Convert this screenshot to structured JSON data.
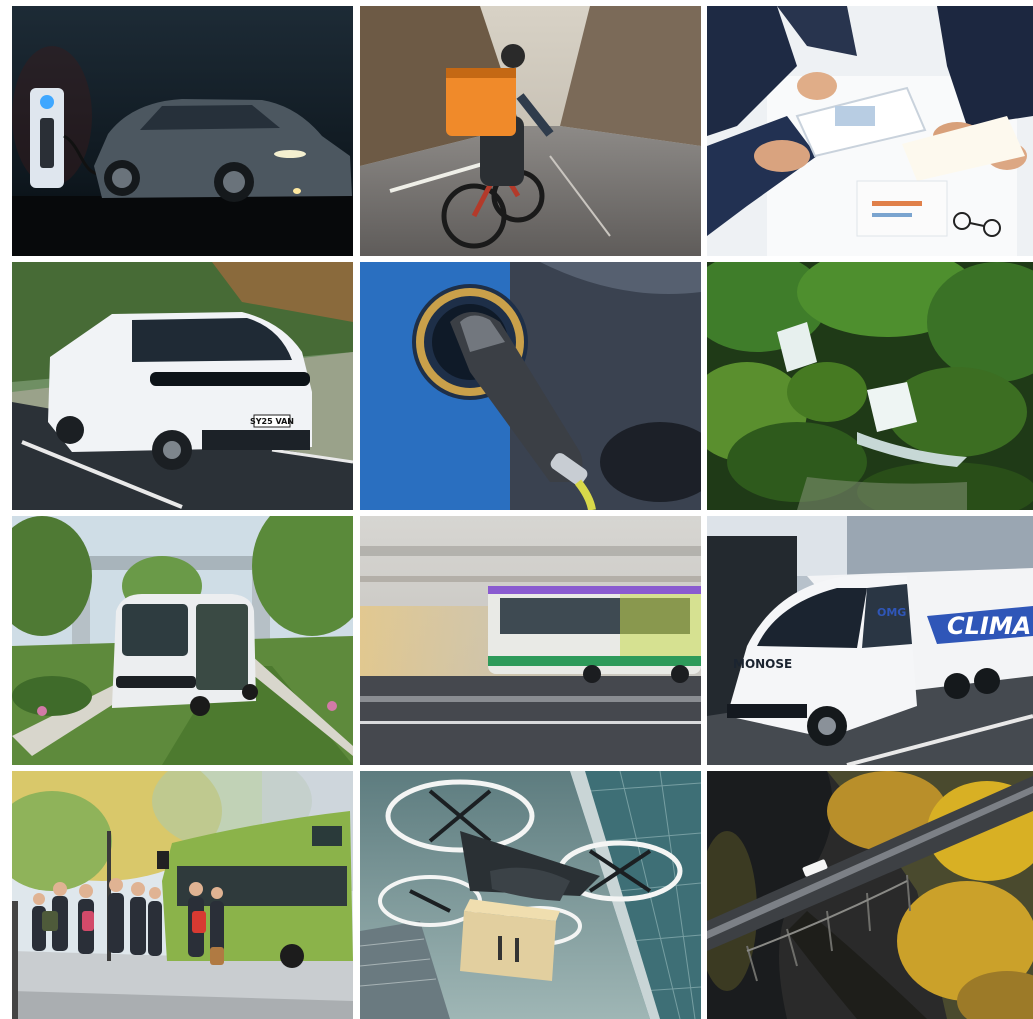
{
  "grid": {
    "rows": 4,
    "columns": 3,
    "tiles": [
      {
        "subject": "ev-charging-sedan"
      },
      {
        "subject": "delivery-cyclist"
      },
      {
        "subject": "business-meeting-documents"
      },
      {
        "subject": "electric-van"
      },
      {
        "subject": "ev-charging-plug"
      },
      {
        "subject": "forest-waterfall"
      },
      {
        "subject": "autonomous-shuttle"
      },
      {
        "subject": "motion-blur-bus"
      },
      {
        "subject": "electric-truck"
      },
      {
        "subject": "commuters-at-bus-stop"
      },
      {
        "subject": "delivery-drone"
      },
      {
        "subject": "aerial-bridge"
      }
    ]
  },
  "plates": {
    "van": "SY25 VAN",
    "truck_cab": "MONOSE",
    "trailer": "CLIMA",
    "truck_side": "OMG"
  },
  "colors": {
    "backpack_orange": "#f08a2a",
    "charger_blue": "#2a6fc0",
    "forest_green": "#3f7d2a",
    "bus_green": "#8bb34a",
    "autumn_yellow": "#d8b024"
  }
}
